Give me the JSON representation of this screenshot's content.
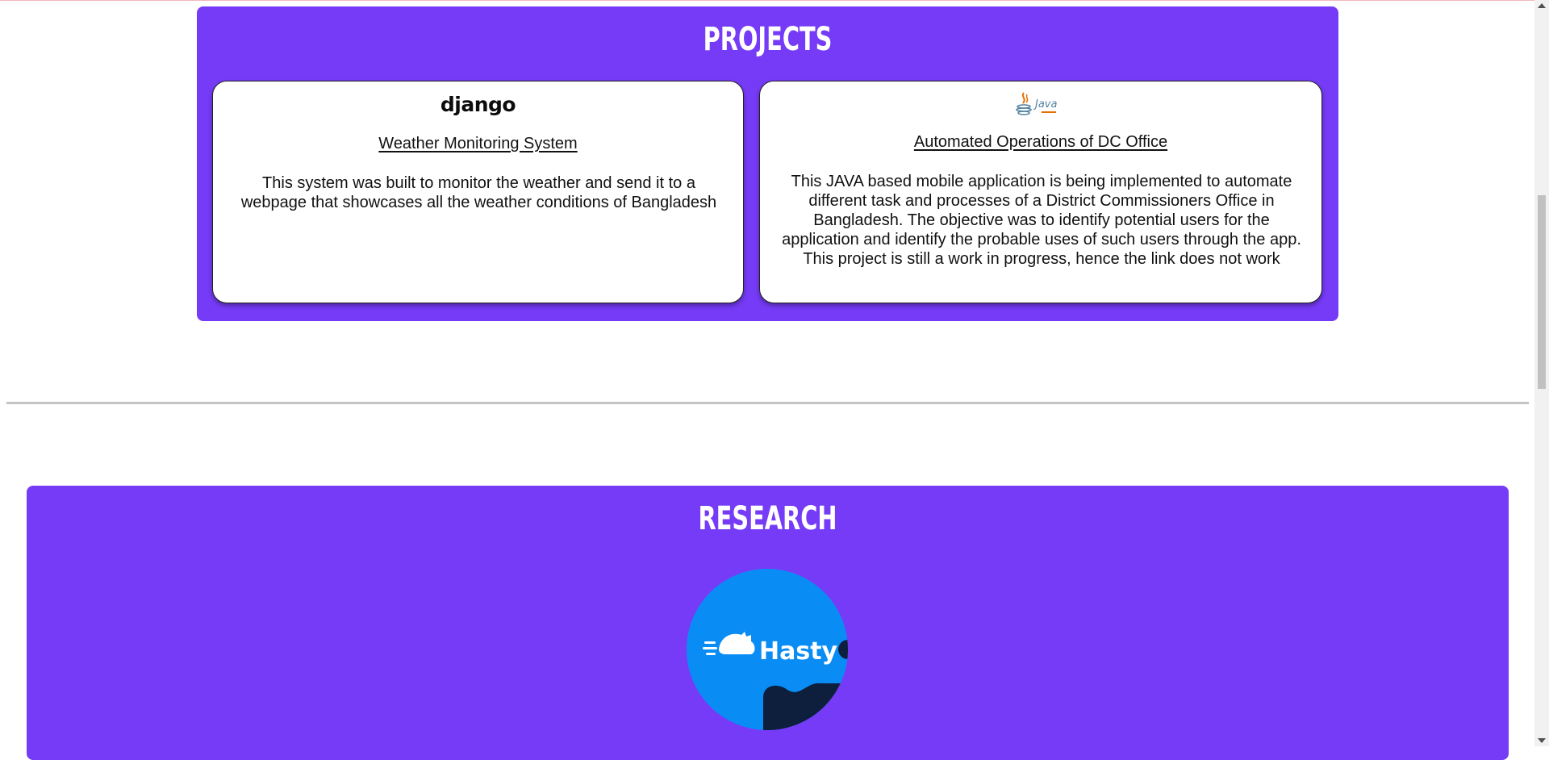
{
  "colors": {
    "section_bg": "#763bf7",
    "card_bg": "#ffffff",
    "hasty_blue": "#0a8cf5",
    "hasty_dark": "#0d1f3c"
  },
  "projects": {
    "title": "PROJECTS",
    "cards": [
      {
        "logo_text": "django",
        "title": "Weather Monitoring System",
        "description": "This system was built to monitor the weather and send it to a webpage that showcases all the weather conditions of Bangladesh"
      },
      {
        "logo_icon": "java-logo-icon",
        "logo_text": "Java",
        "title": "Automated Operations of DC Office",
        "description": "This JAVA based mobile application is being implemented to automate different task and processes of a District Commissioners Office in Bangladesh. The objective was to identify potential users for the application and identify the probable uses of such users through the app. This project is still a work in progress, hence the link does not work"
      }
    ]
  },
  "research": {
    "title": "RESEARCH",
    "logo_text": "Hasty"
  }
}
